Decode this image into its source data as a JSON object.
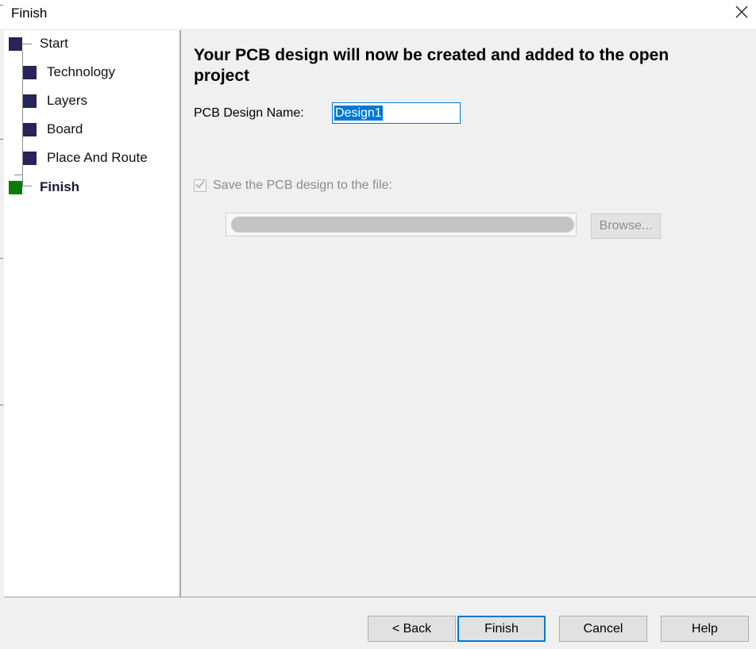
{
  "window": {
    "title": "Finish"
  },
  "sidebar": {
    "items": [
      {
        "label": "Start"
      },
      {
        "label": "Technology"
      },
      {
        "label": "Layers"
      },
      {
        "label": "Board"
      },
      {
        "label": "Place And Route"
      },
      {
        "label": "Finish",
        "current": true
      }
    ]
  },
  "main": {
    "heading": "Your PCB design will now be created and added to the open project",
    "name_label": "PCB Design Name:",
    "name_value": "Design1",
    "save_checked": true,
    "save_label": "Save the PCB design to the file:",
    "browse_label": "Browse..."
  },
  "footer": {
    "back_label": "< Back",
    "finish_label": "Finish",
    "cancel_label": "Cancel",
    "help_label": "Help"
  },
  "colors": {
    "step_done": "#27245a",
    "step_current": "#0a7a0a",
    "accent": "#0078d7"
  }
}
